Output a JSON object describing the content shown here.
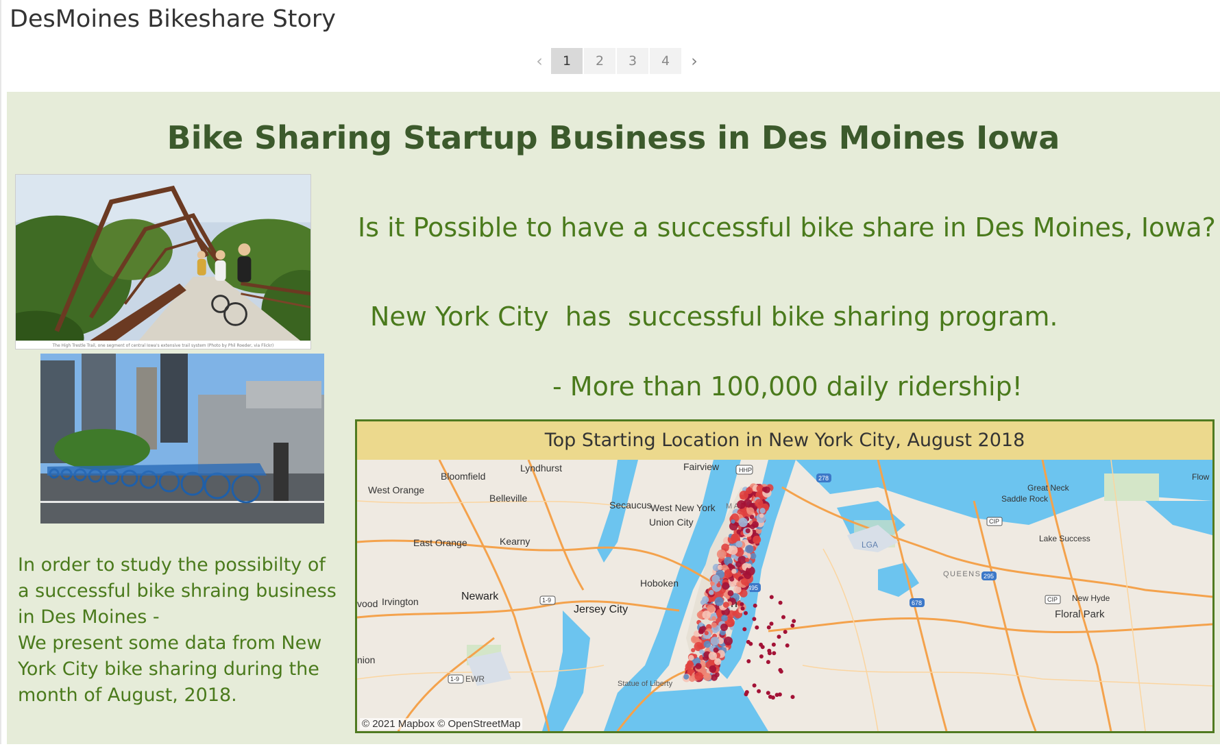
{
  "story": {
    "title": "DesMoines Bikeshare Story",
    "pages": [
      "1",
      "2",
      "3",
      "4"
    ],
    "active_page": "1"
  },
  "dashboard": {
    "headline": "Bike Sharing Startup Business in Des Moines Iowa",
    "question": "Is it Possible to have a successful bike share in Des Moines, Iowa?",
    "nyc_statement": "New York City  has  successful bike sharing program.",
    "ridership": "- More than 100,000 daily ridership!",
    "photo1_caption": "The High Trestle Trail, one segment of central Iowa's extensive trail system (Photo by Phil Roeder, via Flickr)",
    "intro_lines": [
      "In order to study the possibilty of a successful bike shraing business in Des Moines -",
      "We  present some data from New York City bike sharing during the month of  August, 2018."
    ]
  },
  "map": {
    "title": "Top Starting Location in New York City, August 2018",
    "attribution": "© 2021 Mapbox © OpenStreetMap",
    "labels": {
      "lyndhurst": "Lyndhurst",
      "fairview": "Fairview",
      "bloomfield": "Bloomfield",
      "west_orange": "West Orange",
      "belleville": "Belleville",
      "secaucus": "Secaucus",
      "west_new_york": "West New York",
      "union_city": "Union City",
      "east_orange": "East Orange",
      "kearny": "Kearny",
      "hoboken": "Hoboken",
      "newark": "Newark",
      "irvington": "Irvington",
      "vood": "vood",
      "jersey_city": "Jersey City",
      "nion": "nion",
      "ewr": "EWR",
      "statue": "Statue of Liberty",
      "great_neck": "Great Neck",
      "saddle_rock": "Saddle Rock",
      "lake_success": "Lake Success",
      "queens": "QUEENS",
      "new_hyde": "New Hyde",
      "floral_park": "Floral Park",
      "flow": "Flow",
      "lga": "LGA",
      "manhattan_partial": "M  A    A   AN",
      "york_partial": "rk",
      "hwy_hhp": "HHP",
      "hwy_278": "278",
      "hwy_cip1": "CIP",
      "hwy_cip2": "CIP",
      "hwy_295": "295",
      "hwy_678": "678",
      "hwy_19a": "1-9",
      "hwy_19b": "1-9",
      "hwy_495": "495"
    },
    "colors": {
      "water": "#6cc4ef",
      "land": "#efeae2",
      "highway": "#f4a24c",
      "point_dark": "#a31236",
      "point_mid": "#e0413f",
      "point_light": "#f08a78",
      "point_pale": "#f6c3b6",
      "point_blue": "#5e8ac0",
      "point_lightblue": "#9bb6d9"
    }
  }
}
